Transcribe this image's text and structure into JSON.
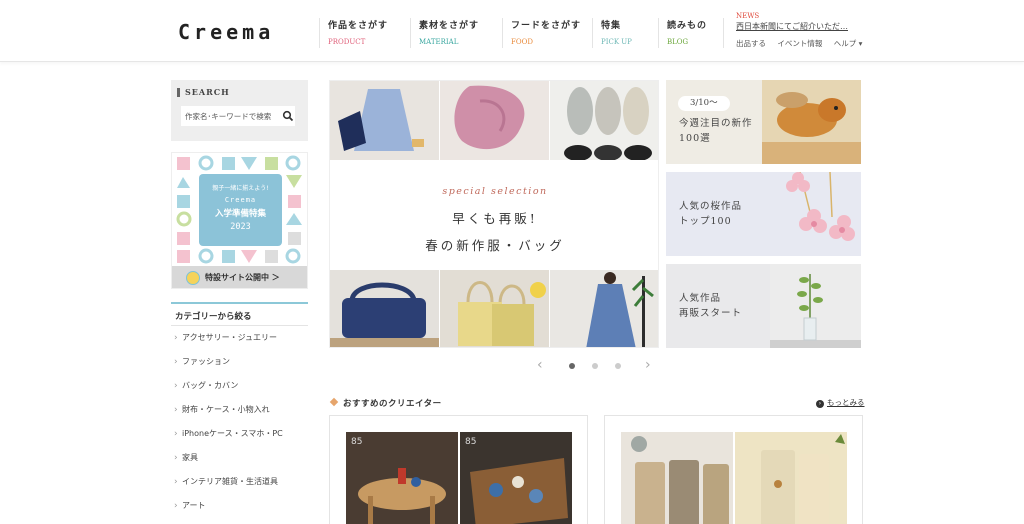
{
  "header": {
    "logo": "Creema",
    "nav": [
      {
        "jp": "作品をさがす",
        "en": "PRODUCT",
        "color": "#e0607a"
      },
      {
        "jp": "素材をさがす",
        "en": "MATERIAL",
        "color": "#3aa7a0"
      },
      {
        "jp": "フードをさがす",
        "en": "FOOD",
        "color": "#e98a3a"
      },
      {
        "jp": "特集",
        "en": "PICK UP",
        "color": "#6cb7b5"
      },
      {
        "jp": "読みもの",
        "en": "BLOG",
        "color": "#6aa63a"
      }
    ],
    "news_tag": "NEWS",
    "news_text": "西日本新聞にてご紹介いただ…",
    "links": [
      "出品する",
      "イベント情報",
      "ヘルプ ▾"
    ]
  },
  "sidebar": {
    "search_label": "SEARCH",
    "search_placeholder": "作家名･キーワードで検索",
    "promo": {
      "line1": "親子一緒に揃えよう!",
      "line2": "Creema",
      "line3": "入学準備特集",
      "line4": "2023",
      "bar": "特設サイト公開中 ＞"
    },
    "category_title": "カテゴリーから絞る",
    "categories": [
      "アクセサリー・ジュエリー",
      "ファッション",
      "バッグ・カバン",
      "財布・ケース・小物入れ",
      "iPhoneケース・スマホ・PC",
      "家具",
      "インテリア雑貨・生活道具",
      "アート"
    ]
  },
  "hero": {
    "special": "special selection",
    "title1": "早くも再販!",
    "title2": "春の新作服・バッグ"
  },
  "side_banners": [
    {
      "date": "3/10〜",
      "line1": "今週注目の新作",
      "line2": "100選"
    },
    {
      "line1": "人気の桜作品",
      "line2": "トップ100"
    },
    {
      "line1": "人気作品",
      "line2": "再販スタート"
    }
  ],
  "carousel": {
    "prev": "‹",
    "next": "›",
    "active_index": 0
  },
  "recommended": {
    "title": "おすすめのクリエイター",
    "more": "もっとみる"
  }
}
